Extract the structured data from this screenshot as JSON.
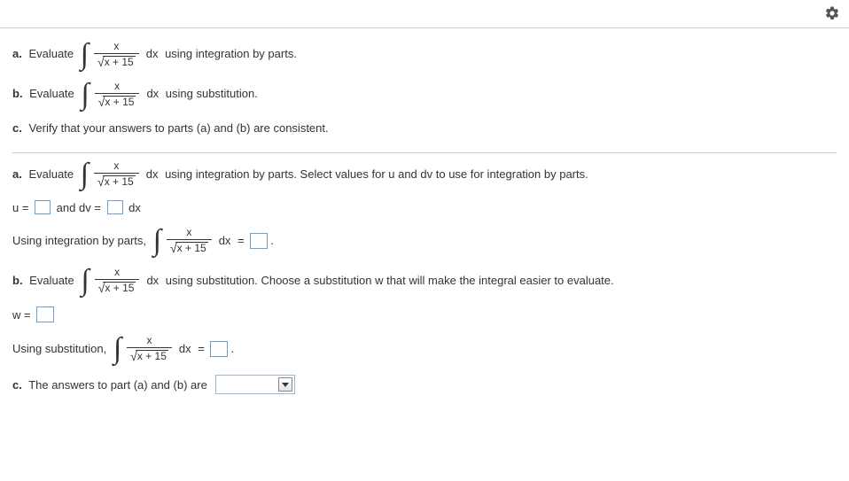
{
  "toolbar": {
    "gear_icon": "settings"
  },
  "math": {
    "integral_numer": "x",
    "integral_denom_radicand": "x + 15",
    "dx": "dx"
  },
  "q": {
    "a_label": "a.",
    "b_label": "b.",
    "c_label": "c.",
    "evaluate": " Evaluate ",
    "a_tail": " using integration by parts.",
    "b_tail": " using substitution.",
    "c_text": " Verify that your answers to parts (a) and (b) are consistent."
  },
  "work": {
    "a_tail": " using integration by parts. Select values for u and dv to use for integration by parts.",
    "u_eq": "u = ",
    "and_dv": " and dv = ",
    "dx_after": " dx",
    "using_parts": "Using integration by parts, ",
    "dx_eq": " = ",
    "period": ".",
    "b_tail": " using substitution. Choose a substitution w that will make the integral easier to evaluate.",
    "w_eq": "w = ",
    "using_sub": "Using substitution, ",
    "c_text": " The answers to part (a) and (b) are "
  }
}
